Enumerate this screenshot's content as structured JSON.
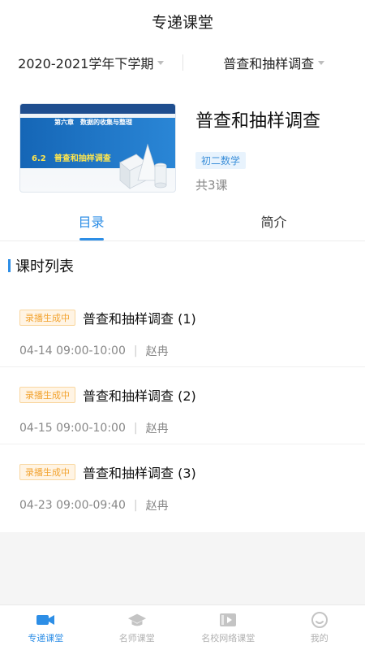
{
  "header": {
    "title": "专递课堂"
  },
  "filters": {
    "term": "2020-2021学年下学期",
    "course": "普查和抽样调查"
  },
  "course": {
    "thumbnail": {
      "chapter": "第六章　数据的收集与整理",
      "lesson": "6.2　普查和抽样调查"
    },
    "title": "普查和抽样调查",
    "grade_tag": "初二数学",
    "lesson_count": "共3课"
  },
  "tabs": [
    {
      "label": "目录",
      "active": true
    },
    {
      "label": "简介",
      "active": false
    }
  ],
  "section": {
    "title": "课时列表"
  },
  "lessons": [
    {
      "status": "录播生成中",
      "title": "普查和抽样调查 (1)",
      "time": "04-14 09:00-10:00",
      "teacher": "赵冉"
    },
    {
      "status": "录播生成中",
      "title": "普查和抽样调查 (2)",
      "time": "04-15 09:00-10:00",
      "teacher": "赵冉"
    },
    {
      "status": "录播生成中",
      "title": "普查和抽样调查 (3)",
      "time": "04-23 09:00-09:40",
      "teacher": "赵冉"
    }
  ],
  "bottom_nav": [
    {
      "label": "专递课堂",
      "icon": "video-camera-icon",
      "active": true
    },
    {
      "label": "名师课堂",
      "icon": "graduation-cap-icon",
      "active": false
    },
    {
      "label": "名校网络课堂",
      "icon": "video-play-icon",
      "active": false
    },
    {
      "label": "我的",
      "icon": "smiley-face-icon",
      "active": false
    }
  ],
  "colors": {
    "accent": "#2d8ee6",
    "badge_text": "#f2a330",
    "badge_bg": "#fff4e4",
    "tag_bg": "#e8f3fd"
  }
}
